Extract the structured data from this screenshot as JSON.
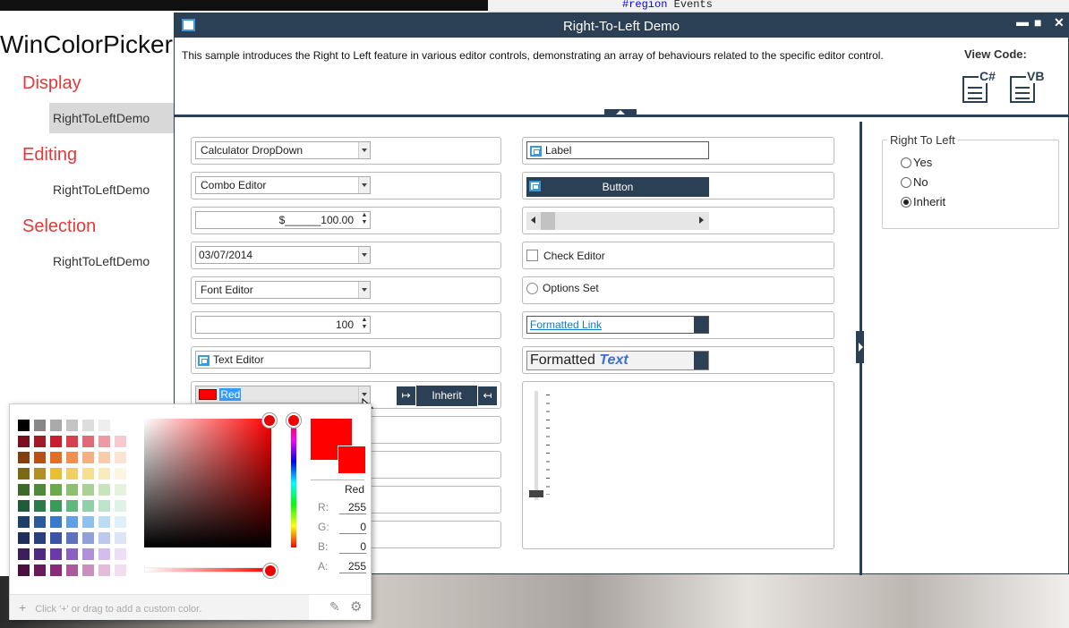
{
  "code_editor": {
    "line_keyword": "#region",
    "line_text": "Events"
  },
  "nav": {
    "app_title": "WinColorPicker",
    "groups": [
      {
        "label": "Display",
        "item": "RightToLeftDemo"
      },
      {
        "label": "Editing",
        "item": "RightToLeftDemo"
      },
      {
        "label": "Selection",
        "item": "RightToLeftDemo"
      }
    ]
  },
  "window": {
    "title": "Right-To-Left Demo",
    "description": "This sample introduces the Right to Left feature in various editor controls, demonstrating an array of behaviours related to the specific editor control.",
    "view_code_label": "View Code:",
    "csharp_label": "C#",
    "vb_label": "VB"
  },
  "left_col": {
    "calculator": "Calculator DropDown",
    "combo": "Combo Editor",
    "currency": "$______100.00",
    "date": "03/07/2014",
    "font": "Font Editor",
    "numeric": "100",
    "text_editor": "Text Editor",
    "color": "Red",
    "rtl_button": "Inherit"
  },
  "mid_col": {
    "label": "Label",
    "button": "Button",
    "check": "Check Editor",
    "options": "Options Set",
    "link": "Formatted Link",
    "formatted_plain": "Formatted",
    "formatted_styled": "Text"
  },
  "rtl_group": {
    "legend": "Right To Left",
    "options": [
      "Yes",
      "No",
      "Inherit"
    ],
    "selected": "Inherit"
  },
  "color_picker": {
    "selected_name": "Red",
    "r_label": "R:",
    "r": "255",
    "g_label": "G:",
    "g": "0",
    "b_label": "B:",
    "b": "0",
    "a_label": "A:",
    "a": "255",
    "add_symbol": "+",
    "custom_hint": "Click '+' or drag to add a custom color.",
    "selected_color": "#ff0000"
  }
}
